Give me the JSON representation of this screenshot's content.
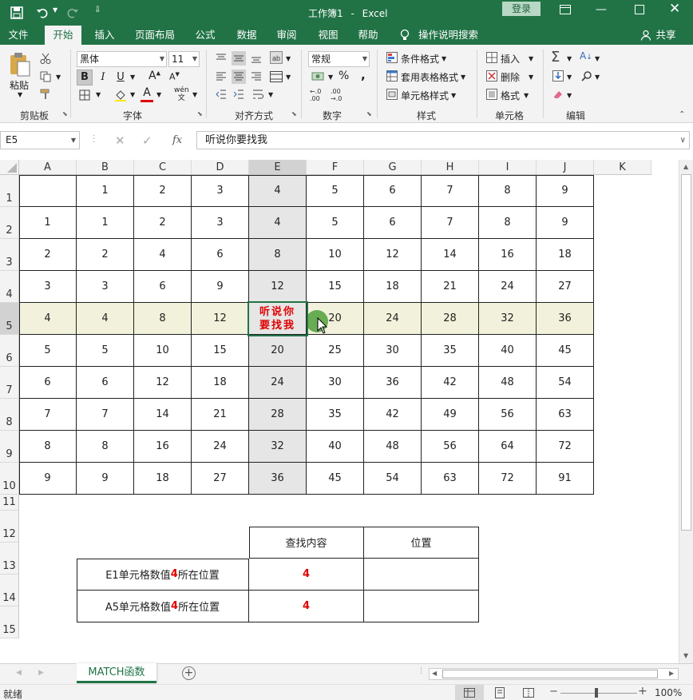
{
  "title": {
    "doc": "工作簿1",
    "sep": "-",
    "app": "Excel",
    "login": "登录",
    "search": "操作说明搜索",
    "share": "共享"
  },
  "tabs": [
    "文件",
    "开始",
    "插入",
    "页面布局",
    "公式",
    "数据",
    "审阅",
    "视图",
    "帮助"
  ],
  "ribbon": {
    "paste": "粘贴",
    "font_name": "黑体",
    "font_size": "11",
    "number_format": "常规",
    "conditional_format": "条件格式",
    "table_format": "套用表格格式",
    "cell_style": "单元格样式",
    "insert": "插入",
    "delete": "删除",
    "format": "格式",
    "groups": [
      "剪贴板",
      "字体",
      "对齐方式",
      "数字",
      "样式",
      "单元格",
      "编辑"
    ],
    "bold": "B",
    "italic": "I",
    "underline": "U",
    "font_grow": "A",
    "font_shrink": "A",
    "font_color_letter": "A",
    "percent": "%",
    "comma": ",",
    "phonetic": "wén"
  },
  "formula_bar": {
    "name_box": "E5",
    "fx": "fx",
    "content": "听说你要找我"
  },
  "columns": [
    "A",
    "B",
    "C",
    "D",
    "E",
    "F",
    "G",
    "H",
    "I",
    "J",
    "K"
  ],
  "rows": [
    "1",
    "2",
    "3",
    "4",
    "5",
    "6",
    "7",
    "8",
    "9",
    "10",
    "11",
    "12",
    "13",
    "14",
    "15"
  ],
  "table": [
    [
      "",
      "1",
      "2",
      "3",
      "4",
      "5",
      "6",
      "7",
      "8",
      "9"
    ],
    [
      "1",
      "1",
      "2",
      "3",
      "4",
      "5",
      "6",
      "7",
      "8",
      "9"
    ],
    [
      "2",
      "2",
      "4",
      "6",
      "8",
      "10",
      "12",
      "14",
      "16",
      "18"
    ],
    [
      "3",
      "3",
      "6",
      "9",
      "12",
      "15",
      "18",
      "21",
      "24",
      "27"
    ],
    [
      "4",
      "4",
      "8",
      "12",
      "听说你要找我",
      "20",
      "24",
      "28",
      "32",
      "36"
    ],
    [
      "5",
      "5",
      "10",
      "15",
      "20",
      "25",
      "30",
      "35",
      "40",
      "45"
    ],
    [
      "6",
      "6",
      "12",
      "18",
      "24",
      "30",
      "36",
      "42",
      "48",
      "54"
    ],
    [
      "7",
      "7",
      "14",
      "21",
      "28",
      "35",
      "42",
      "49",
      "56",
      "63"
    ],
    [
      "8",
      "8",
      "16",
      "24",
      "32",
      "40",
      "48",
      "56",
      "64",
      "72"
    ],
    [
      "9",
      "9",
      "18",
      "27",
      "36",
      "45",
      "54",
      "63",
      "72",
      "91"
    ]
  ],
  "lookup": {
    "header_content": "查找内容",
    "header_position": "位置",
    "row1": {
      "label_pre": "E1单元格数值",
      "label_num": "4",
      "label_post": "所在位置",
      "value": "4",
      "position": ""
    },
    "row2": {
      "label_pre": "A5单元格数值",
      "label_num": "4",
      "label_post": "所在位置",
      "value": "4",
      "position": ""
    }
  },
  "sheet_tab": "MATCH函数",
  "status": {
    "ready": "就绪",
    "zoom": "100%",
    "minus": "−",
    "plus": "+"
  },
  "colors": {
    "accent": "#217346",
    "highlight_row": "#f2f2dc",
    "highlight_col": "#e6e6e6",
    "red": "#e00000"
  }
}
